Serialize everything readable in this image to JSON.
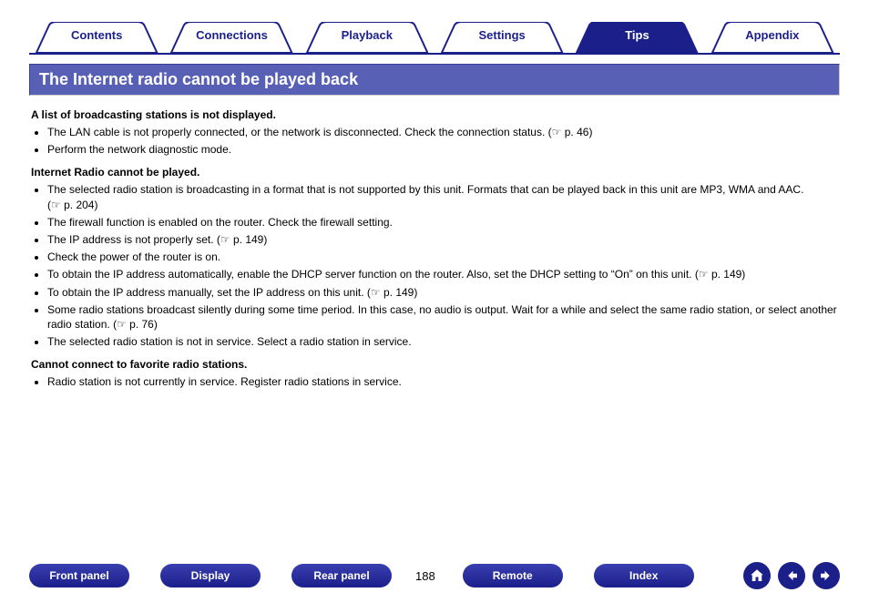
{
  "tabs": [
    {
      "label": "Contents",
      "active": false
    },
    {
      "label": "Connections",
      "active": false
    },
    {
      "label": "Playback",
      "active": false
    },
    {
      "label": "Settings",
      "active": false
    },
    {
      "label": "Tips",
      "active": true
    },
    {
      "label": "Appendix",
      "active": false
    }
  ],
  "title": "The Internet radio cannot be played back",
  "sections": [
    {
      "heading": "A list of broadcasting stations is not displayed.",
      "items": [
        {
          "text": "The LAN cable is not properly connected, or the network is disconnected. Check the connection status.",
          "pref": "p. 46"
        },
        {
          "text": "Perform the network diagnostic mode."
        }
      ]
    },
    {
      "heading": "Internet Radio cannot be played.",
      "items": [
        {
          "text": "The selected radio station is broadcasting in a format that is not supported by this unit. Formats that can be played back in this unit are MP3, WMA and AAC.",
          "pref": "p. 204"
        },
        {
          "text": "The firewall function is enabled on the router. Check the firewall setting."
        },
        {
          "text": "The IP address is not properly set.",
          "pref": "p. 149"
        },
        {
          "text": "Check the power of the router is on."
        },
        {
          "text": "To obtain the IP address automatically, enable the DHCP server function on the router. Also, set the DHCP setting to “On” on this unit.",
          "pref": "p. 149"
        },
        {
          "text": "To obtain the IP address manually, set the IP address on this unit.",
          "pref": "p. 149"
        },
        {
          "text": "Some radio stations broadcast silently during some time period. In this case, no audio is output. Wait for a while and select the same radio station, or select another radio station.",
          "pref": "p. 76"
        },
        {
          "text": "The selected radio station is not in service. Select a radio station in service."
        }
      ]
    },
    {
      "heading": "Cannot connect to favorite radio stations.",
      "items": [
        {
          "text": "Radio station is not currently in service. Register radio stations in service."
        }
      ]
    }
  ],
  "bottom": {
    "buttons": [
      "Front panel",
      "Display",
      "Rear panel"
    ],
    "page_number": "188",
    "buttons2": [
      "Remote",
      "Index"
    ]
  },
  "icons": {
    "home": "home-icon",
    "prev": "prev-icon",
    "next": "next-icon",
    "pointer": "☞"
  },
  "colors": {
    "brand": "#1b1f8a",
    "tab_active_bg": "#1b1f8a",
    "title_bg": "#5760b4"
  }
}
